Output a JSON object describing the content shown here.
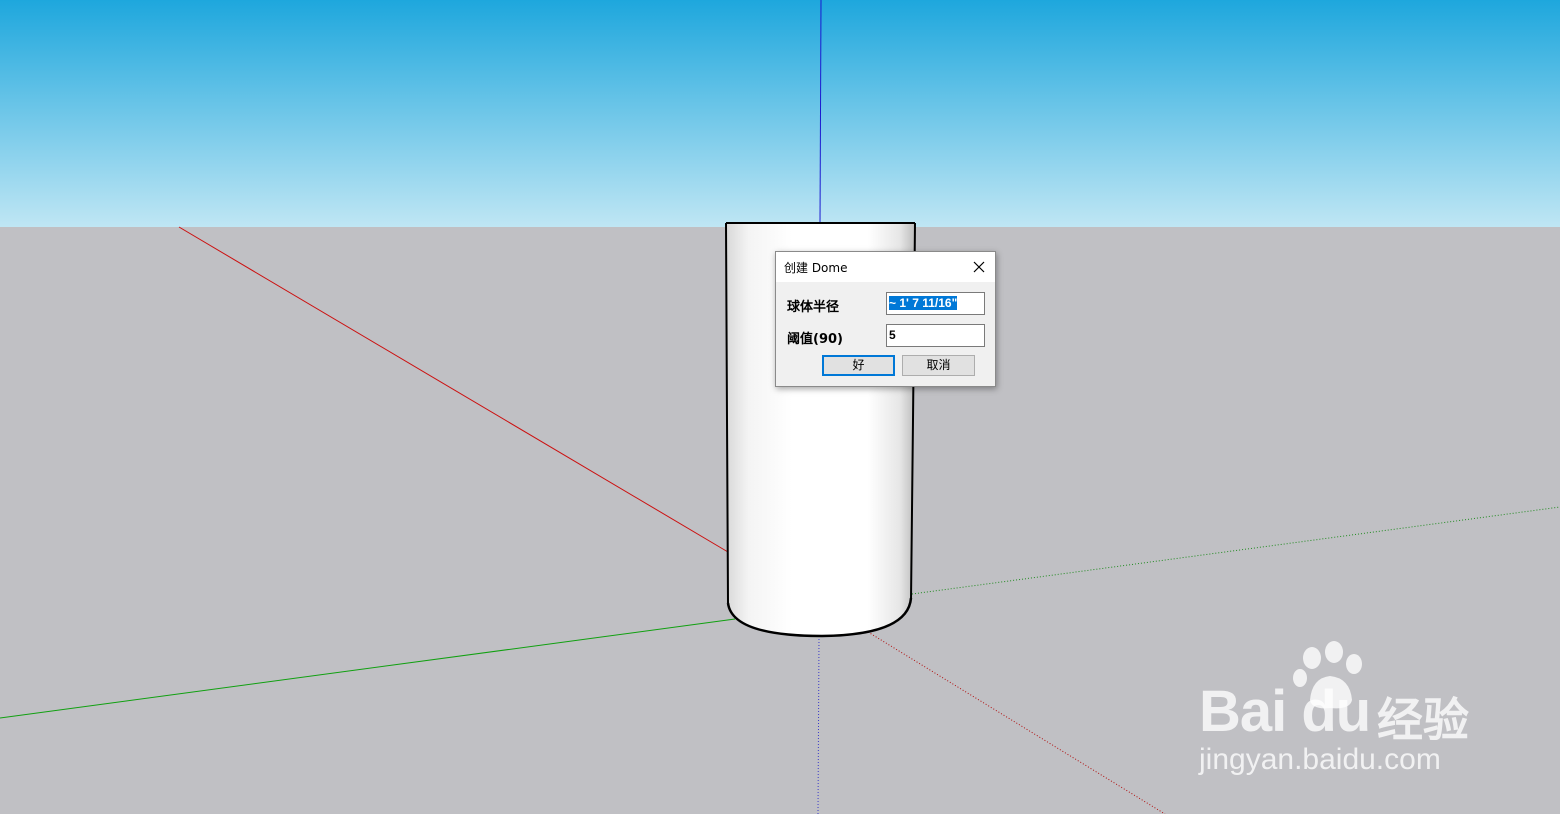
{
  "scene": {
    "sky_top_color": "#1ea7dd",
    "sky_bottom_color": "#b8e3f3",
    "ground_color": "#c0c0c4",
    "axis_colors": {
      "red": "#cc0000",
      "green": "#00aa00",
      "blue": "#0000cc"
    },
    "model": "cylinder"
  },
  "dialog": {
    "title": "创建 Dome",
    "fields": [
      {
        "label": "球体半径",
        "value": "~ 1' 7 11/16\""
      },
      {
        "label": "阈值(90)",
        "value": "5"
      }
    ],
    "ok_label": "好",
    "cancel_label": "取消"
  },
  "watermark": {
    "brand": "Bai du",
    "brand_cn": "经验",
    "url": "jingyan.baidu.com"
  }
}
